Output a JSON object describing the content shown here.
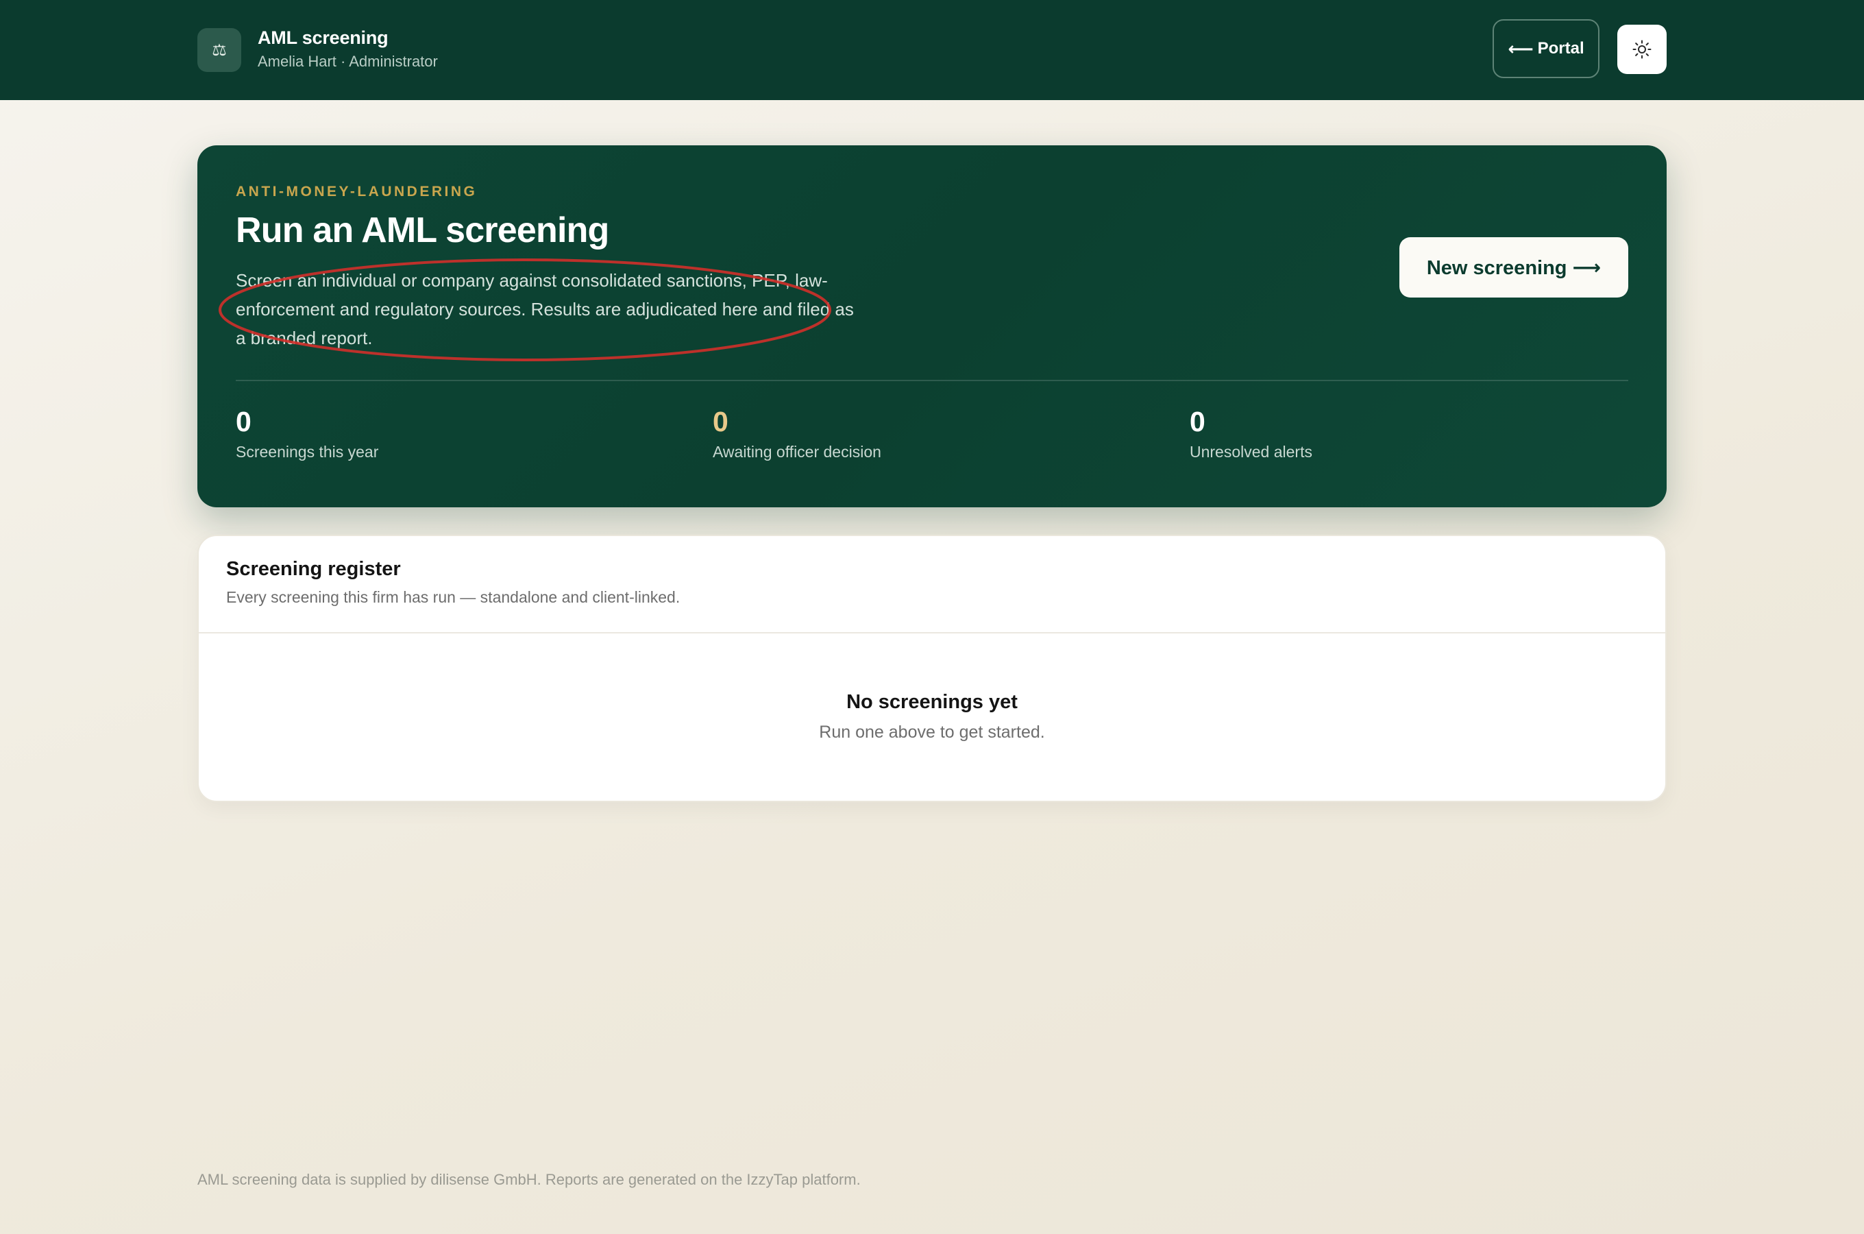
{
  "header": {
    "brand_icon": "scales-icon",
    "brand_glyph": "⚖",
    "title": "AML screening",
    "user": "Amelia Hart · Administrator",
    "portal_label": "Portal",
    "portal_arrow": "⟵",
    "theme_icon": "sun-icon"
  },
  "hero": {
    "eyebrow": "ANTI-MONEY-LAUNDERING",
    "title": "Run an AML screening",
    "description": "Screen an individual or company against consolidated sanctions, PEP, law-enforcement and regulatory sources. Results are adjudicated here and filed as a branded report.",
    "new_button_label": "New screening ⟶",
    "stats": [
      {
        "value": "0",
        "label": "Screenings this year"
      },
      {
        "value": "0",
        "label": "Awaiting officer decision"
      },
      {
        "value": "0",
        "label": "Unresolved alerts"
      }
    ]
  },
  "register": {
    "title": "Screening register",
    "subtitle": "Every screening this firm has run — standalone and client-linked.",
    "empty_title": "No screenings yet",
    "empty_subtitle": "Run one above to get started."
  },
  "footer": {
    "note": "AML screening data is supplied by dilisense GmbH. Reports are generated on the IzzyTap platform."
  },
  "colors": {
    "header_bg": "#0b3b2e",
    "hero_bg": "#0d4535",
    "eyebrow": "#c9a64e",
    "amber_stat": "#e9c98a",
    "annotation": "#d0302a"
  }
}
